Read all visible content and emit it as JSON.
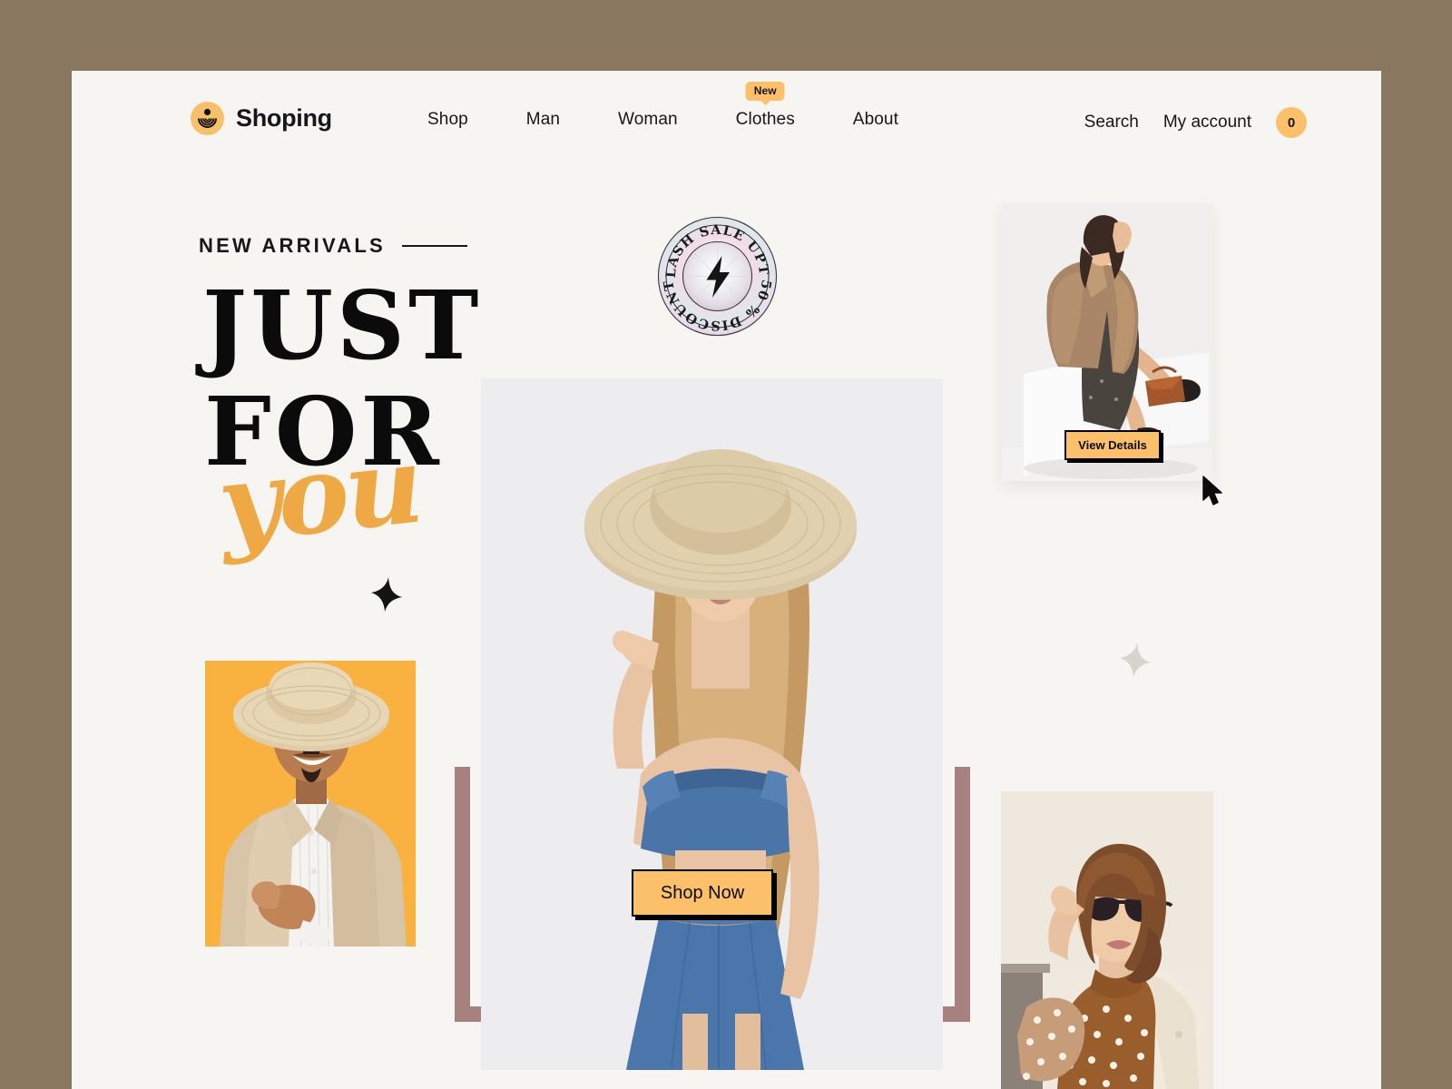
{
  "theme": {
    "page_background": "#897760",
    "card_background": "#F6F5F1",
    "accent": "#FBC069",
    "accent_strong": "#F9B13F",
    "script_accent": "#EFA944",
    "frame_mauve": "#A6817F",
    "ink": "#17161A"
  },
  "header": {
    "brand": "Shoping",
    "logo_icon": "radar-smiley-logo-icon",
    "nav": [
      {
        "label": "Shop",
        "badge": null
      },
      {
        "label": "Man",
        "badge": null
      },
      {
        "label": "Woman",
        "badge": null
      },
      {
        "label": "Clothes",
        "badge": "New"
      },
      {
        "label": "About",
        "badge": null
      }
    ],
    "actions": {
      "search_label": "Search",
      "account_label": "My account",
      "cart_count": "0"
    }
  },
  "hero": {
    "eyebrow": "NEW ARRIVALS",
    "title_line1": "JUST",
    "title_line2": "FOR",
    "title_script": "you",
    "cta_label": "Shop Now",
    "image_alt": "blonde-model-straw-hat-denim-set"
  },
  "flash_sale": {
    "text_top": "FLASH SALE",
    "text_right": "UPTO",
    "text_bottom": "50 % DISCOUNT",
    "full_text": "FLASH SALE UPTO 50 % DISCOUNT",
    "center_icon": "lightning-bolt-icon"
  },
  "cards": {
    "top_right": {
      "image_alt": "woman-teddy-coat-sitting-white-cube",
      "cta_label": "View Details"
    },
    "man": {
      "image_alt": "smiling-man-straw-hat-beige-blazer-pointing"
    },
    "bottom_right": {
      "image_alt": "woman-cat-eye-sunglasses-polka-dot-blouse"
    }
  },
  "decor": {
    "sparkle_dark": "four-point-star-icon",
    "sparkle_light": "four-point-star-icon",
    "cursor": "mouse-arrow-cursor-icon"
  }
}
